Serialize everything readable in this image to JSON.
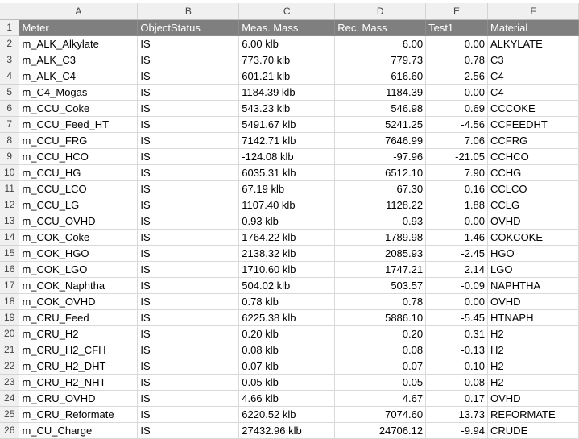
{
  "columns": [
    "A",
    "B",
    "C",
    "D",
    "E",
    "F"
  ],
  "header": [
    "Meter",
    "ObjectStatus",
    "Meas. Mass",
    "Rec. Mass",
    "Test1",
    "Material"
  ],
  "rows": [
    [
      "m_ALK_Alkylate",
      "IS",
      "6.00 klb",
      "6.00",
      "0.00",
      "ALKYLATE"
    ],
    [
      "m_ALK_C3",
      "IS",
      "773.70 klb",
      "779.73",
      "0.78",
      "C3"
    ],
    [
      "m_ALK_C4",
      "IS",
      "601.21 klb",
      "616.60",
      "2.56",
      "C4"
    ],
    [
      "m_C4_Mogas",
      "IS",
      "1184.39 klb",
      "1184.39",
      "0.00",
      "C4"
    ],
    [
      "m_CCU_Coke",
      "IS",
      "543.23 klb",
      "546.98",
      "0.69",
      "CCCOKE"
    ],
    [
      "m_CCU_Feed_HT",
      "IS",
      "5491.67 klb",
      "5241.25",
      "-4.56",
      "CCFEEDHT"
    ],
    [
      "m_CCU_FRG",
      "IS",
      "7142.71 klb",
      "7646.99",
      "7.06",
      "CCFRG"
    ],
    [
      "m_CCU_HCO",
      "IS",
      "-124.08 klb",
      "-97.96",
      "-21.05",
      "CCHCO"
    ],
    [
      "m_CCU_HG",
      "IS",
      "6035.31 klb",
      "6512.10",
      "7.90",
      "CCHG"
    ],
    [
      "m_CCU_LCO",
      "IS",
      "67.19 klb",
      "67.30",
      "0.16",
      "CCLCO"
    ],
    [
      "m_CCU_LG",
      "IS",
      "1107.40 klb",
      "1128.22",
      "1.88",
      "CCLG"
    ],
    [
      "m_CCU_OVHD",
      "IS",
      "0.93 klb",
      "0.93",
      "0.00",
      "OVHD"
    ],
    [
      "m_COK_Coke",
      "IS",
      "1764.22 klb",
      "1789.98",
      "1.46",
      "COKCOKE"
    ],
    [
      "m_COK_HGO",
      "IS",
      "2138.32 klb",
      "2085.93",
      "-2.45",
      "HGO"
    ],
    [
      "m_COK_LGO",
      "IS",
      "1710.60 klb",
      "1747.21",
      "2.14",
      "LGO"
    ],
    [
      "m_COK_Naphtha",
      "IS",
      "504.02 klb",
      "503.57",
      "-0.09",
      "NAPHTHA"
    ],
    [
      "m_COK_OVHD",
      "IS",
      "0.78 klb",
      "0.78",
      "0.00",
      "OVHD"
    ],
    [
      "m_CRU_Feed",
      "IS",
      "6225.38 klb",
      "5886.10",
      "-5.45",
      "HTNAPH"
    ],
    [
      "m_CRU_H2",
      "IS",
      "0.20 klb",
      "0.20",
      "0.31",
      "H2"
    ],
    [
      "m_CRU_H2_CFH",
      "IS",
      "0.08 klb",
      "0.08",
      "-0.13",
      "H2"
    ],
    [
      "m_CRU_H2_DHT",
      "IS",
      "0.07 klb",
      "0.07",
      "-0.10",
      "H2"
    ],
    [
      "m_CRU_H2_NHT",
      "IS",
      "0.05 klb",
      "0.05",
      "-0.08",
      "H2"
    ],
    [
      "m_CRU_OVHD",
      "IS",
      "4.66 klb",
      "4.67",
      "0.17",
      "OVHD"
    ],
    [
      "m_CRU_Reformate",
      "IS",
      "6220.52 klb",
      "7074.60",
      "13.73",
      "REFORMATE"
    ],
    [
      "m_CU_Charge",
      "IS",
      "27432.96 klb",
      "24706.12",
      "-9.94",
      "CRUDE"
    ]
  ]
}
